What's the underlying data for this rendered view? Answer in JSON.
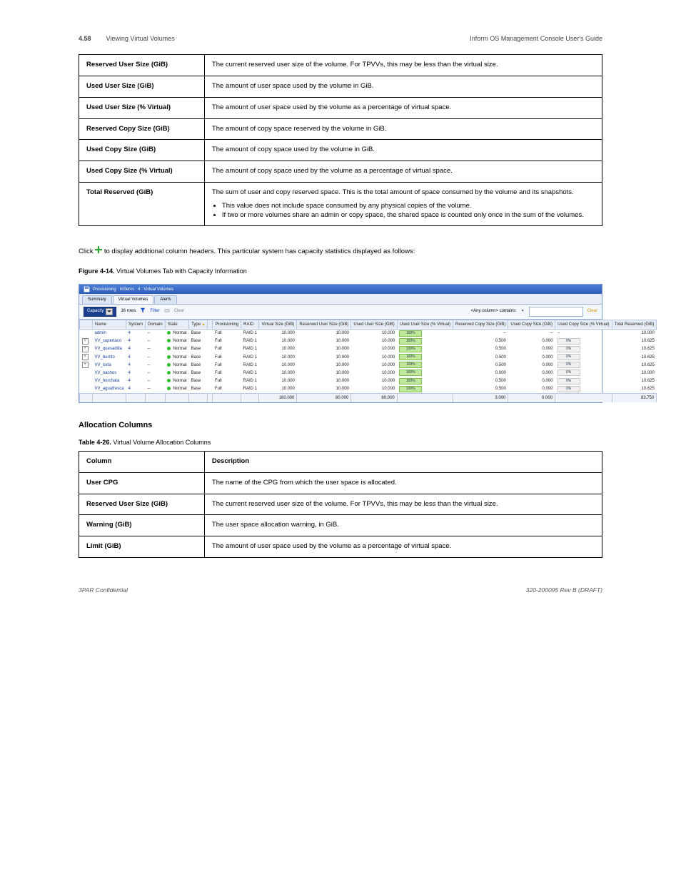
{
  "header": {
    "chapter_no": "4.58",
    "chapter": "Viewing Virtual Volumes",
    "right": "Inform OS Management Console User's Guide"
  },
  "upper_rows": [
    {
      "k": "Reserved User Size (GiB)",
      "v": "The current reserved user size of the volume. For TPVVs, this may be less than the virtual size."
    },
    {
      "k": "Used User Size (GiB)",
      "v": "The amount of user space used by the volume in GiB."
    },
    {
      "k": "Used User Size (% Virtual)",
      "v": "The amount of user space used by the volume as a percentage of virtual space."
    },
    {
      "k": "Reserved Copy Size (GiB)",
      "v": "The amount of copy space reserved by the volume in GiB."
    },
    {
      "k": "Used Copy Size (GiB)",
      "v": "The amount of copy space used by the volume in GiB."
    },
    {
      "k": "Used Copy Size (% Virtual)",
      "v": "The amount of copy space used by the volume as a percentage of virtual space."
    },
    {
      "k": "Total Reserved (GiB)",
      "v": "The sum of user and copy reserved space. This is the total amount of space consumed by the volume and its snapshots.",
      "notes": [
        "This value does not include space consumed by any physical copies of the volume.",
        "If two or more volumes share an admin or copy space, the shared space is counted only once in the sum of the volumes."
      ]
    }
  ],
  "figlead_prefix": "Click ",
  "figlead_icon_label": "add-icon",
  "figlead_rest": " to display additional column headers. This particular system has capacity statistics displayed as follows:",
  "figtitle": {
    "no": "Figure 4-14.",
    "txt": "Virtual Volumes Tab with Capacity Information"
  },
  "ss": {
    "title": "Provisioning : InServs : 4 : Virtual Volumes",
    "tabs": [
      "Summary",
      "Virtual Volumes",
      "Alerts"
    ],
    "active_tab": 1,
    "dropdown": "Capacity",
    "rowcount": "16 rows",
    "filter": "Filter",
    "clear": "Clear",
    "anycol": "<Any column> contains:",
    "filter_placeholder": "",
    "clear2": "Clear",
    "columns": [
      "",
      "Name",
      "System",
      "Domain",
      "State",
      "Type",
      "",
      "Provisioning",
      "RAID",
      "Virtual Size (GiB)",
      "Reserved User Size (GiB)",
      "Used User Size (GiB)",
      "Used User Size (% Virtual)",
      "Reserved Copy Size (GiB)",
      "Used Copy Size (GiB)",
      "Used Copy Size (% Virtual)",
      "Total Reserved (GiB)"
    ],
    "rows": [
      {
        "exp": false,
        "name": "admin",
        "system": "4",
        "domain": "--",
        "state": "Normal",
        "type": "Base",
        "prov": "Full",
        "raid": "RAID 1",
        "vs": "10.000",
        "rus": "10.000",
        "uus": "10.000",
        "uuspct": "100%",
        "rcs": "--",
        "ucs": "--",
        "ucspct": "--",
        "tot": "10.000"
      },
      {
        "exp": true,
        "name": "VV_supertaco",
        "system": "4",
        "domain": "--",
        "state": "Normal",
        "type": "Base",
        "prov": "Full",
        "raid": "RAID 1",
        "vs": "10.000",
        "rus": "10.000",
        "uus": "10.000",
        "uuspct": "100%",
        "rcs": "0.500",
        "ucs": "0.000",
        "ucspct": "0%",
        "tot": "10.625"
      },
      {
        "exp": true,
        "name": "VV_quesadilla",
        "system": "4",
        "domain": "--",
        "state": "Normal",
        "type": "Base",
        "prov": "Full",
        "raid": "RAID 1",
        "vs": "10.000",
        "rus": "10.000",
        "uus": "10.000",
        "uuspct": "100%",
        "rcs": "0.500",
        "ucs": "0.000",
        "ucspct": "0%",
        "tot": "10.625"
      },
      {
        "exp": true,
        "name": "VV_burrito",
        "system": "4",
        "domain": "--",
        "state": "Normal",
        "type": "Base",
        "prov": "Full",
        "raid": "RAID 1",
        "vs": "10.000",
        "rus": "10.000",
        "uus": "10.000",
        "uuspct": "100%",
        "rcs": "0.500",
        "ucs": "0.000",
        "ucspct": "0%",
        "tot": "10.625"
      },
      {
        "exp": true,
        "name": "VV_torta",
        "system": "4",
        "domain": "--",
        "state": "Normal",
        "type": "Base",
        "prov": "Full",
        "raid": "RAID 1",
        "vs": "10.000",
        "rus": "10.000",
        "uus": "10.000",
        "uuspct": "100%",
        "rcs": "0.500",
        "ucs": "0.000",
        "ucspct": "0%",
        "tot": "10.625"
      },
      {
        "exp": false,
        "name": "VV_nachos",
        "system": "4",
        "domain": "--",
        "state": "Normal",
        "type": "Base",
        "prov": "Full",
        "raid": "RAID 1",
        "vs": "10.000",
        "rus": "10.000",
        "uus": "10.000",
        "uuspct": "100%",
        "rcs": "0.000",
        "ucs": "0.000",
        "ucspct": "0%",
        "tot": "10.000"
      },
      {
        "exp": false,
        "name": "VV_horchata",
        "system": "4",
        "domain": "--",
        "state": "Normal",
        "type": "Base",
        "prov": "Full",
        "raid": "RAID 1",
        "vs": "10.000",
        "rus": "10.000",
        "uus": "10.000",
        "uuspct": "100%",
        "rcs": "0.500",
        "ucs": "0.000",
        "ucspct": "0%",
        "tot": "10.625"
      },
      {
        "exp": false,
        "name": "VV_aguafresca",
        "system": "4",
        "domain": "--",
        "state": "Normal",
        "type": "Base",
        "prov": "Full",
        "raid": "RAID 1",
        "vs": "10.000",
        "rus": "10.000",
        "uus": "10.000",
        "uuspct": "100%",
        "rcs": "0.500",
        "ucs": "0.000",
        "ucspct": "0%",
        "tot": "10.625"
      }
    ],
    "totals": {
      "vs": "160.000",
      "rus": "80.000",
      "uus": "80.000",
      "rcs": "3.000",
      "ucs": "0.000",
      "tot": "83.750"
    }
  },
  "h2": "Allocation Columns",
  "tblhead": {
    "no": "Table 4-26.",
    "txt": "Virtual Volume Allocation Columns"
  },
  "lower_head": {
    "k": "Column",
    "v": "Description"
  },
  "lower_rows": [
    {
      "k": "User CPG",
      "v": "The name of the CPG from which the user space is allocated."
    },
    {
      "k": "Reserved User Size (GiB)",
      "v": "The current reserved user size of the volume. For TPVVs, this may be less than the virtual size."
    },
    {
      "k": "Warning (GiB)",
      "v": "The user space allocation warning, in GiB."
    },
    {
      "k": "Limit (GiB)",
      "v": "The amount of user space used by the volume as a percentage of virtual space."
    }
  ],
  "footer": {
    "company": "3PAR Confidential",
    "code": "320-200095 Rev B (DRAFT)"
  }
}
